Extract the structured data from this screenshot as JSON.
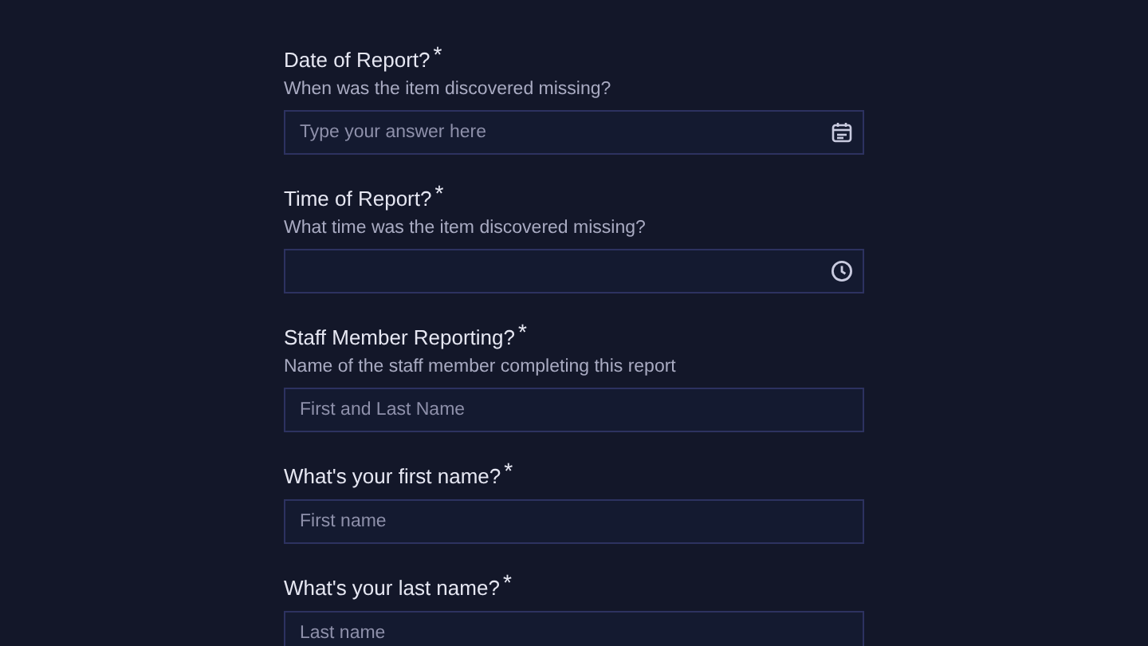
{
  "fields": [
    {
      "kind": "date",
      "label": "Date of Report?",
      "required_mark": "*",
      "help": "When was the item discovered missing?",
      "placeholder": "Type your answer here"
    },
    {
      "kind": "time",
      "label": "Time of Report?",
      "required_mark": "*",
      "help": "What time was the item discovered missing?"
    },
    {
      "kind": "text",
      "label": "Staff Member Reporting?",
      "required_mark": "*",
      "help": "Name of the staff member completing this report",
      "placeholder": "First and Last Name"
    },
    {
      "kind": "text",
      "label": "What's your first name?",
      "required_mark": "*",
      "placeholder": "First name"
    },
    {
      "kind": "text",
      "label": "What's your last name?",
      "required_mark": "*",
      "placeholder": "Last name"
    }
  ]
}
